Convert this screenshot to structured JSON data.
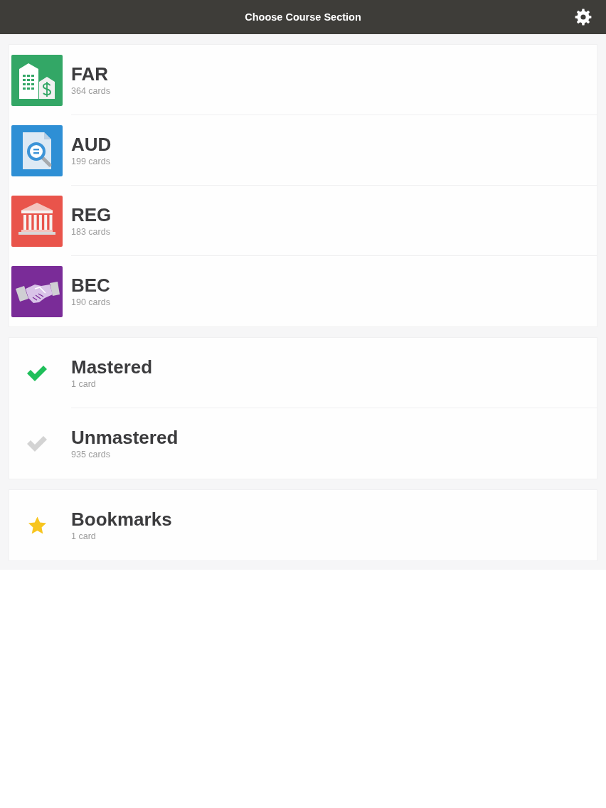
{
  "header": {
    "title": "Choose Course Section"
  },
  "sections": [
    {
      "name": "FAR",
      "count": "364 cards",
      "kind": "buildings",
      "color": "#33a766"
    },
    {
      "name": "AUD",
      "count": "199 cards",
      "kind": "document",
      "color": "#2e8fd5"
    },
    {
      "name": "REG",
      "count": "183 cards",
      "kind": "columns",
      "color": "#e9544b"
    },
    {
      "name": "BEC",
      "count": "190 cards",
      "kind": "handshake",
      "color": "#7a2c98"
    }
  ],
  "filters": [
    {
      "name": "Mastered",
      "count": "1 card",
      "kind": "tick",
      "color": "#1fbf5a"
    },
    {
      "name": "Unmastered",
      "count": "935 cards",
      "kind": "tick",
      "color": "#d3d3d3"
    }
  ],
  "bookmarks": [
    {
      "name": "Bookmarks",
      "count": "1 card",
      "kind": "star"
    }
  ]
}
